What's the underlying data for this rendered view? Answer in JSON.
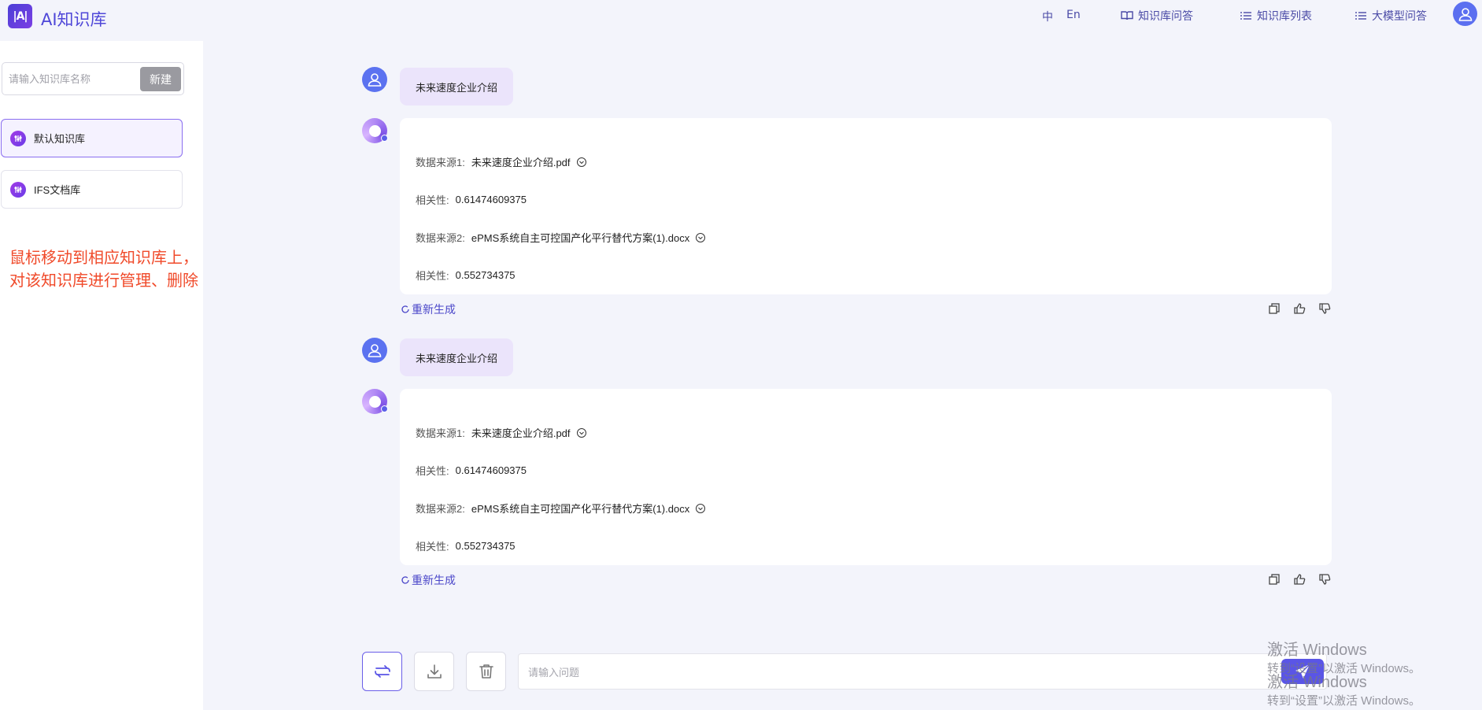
{
  "header": {
    "logo_mark": "|A|",
    "app_title": "AI知识库",
    "lang_zh": "中",
    "lang_en": "En",
    "nav": [
      {
        "label": "知识库问答",
        "icon": "book-icon"
      },
      {
        "label": "知识库列表",
        "icon": "list-icon"
      },
      {
        "label": "大模型问答",
        "icon": "list-icon"
      }
    ],
    "user_icon": "user-icon"
  },
  "sidebar": {
    "search_placeholder": "请输入知识库名称",
    "new_button": "新建",
    "items": [
      {
        "label": "默认知识库",
        "active": true,
        "icon": "knowledge-base-icon"
      },
      {
        "label": "IFS文档库",
        "active": false,
        "icon": "knowledge-base-icon"
      }
    ],
    "annotation_line1": "鼠标移动到相应知识库上，",
    "annotation_line2": "对该知识库进行管理、删除"
  },
  "conversation": [
    {
      "question": "未来速度企业介绍",
      "answer": {
        "source1_label": "数据来源1:",
        "source1_file": "未来速度企业介绍.pdf",
        "relevance1_label": "相关性:",
        "relevance1_value": "0.61474609375",
        "source2_label": "数据来源2:",
        "source2_file": "ePMS系统自主可控国产化平行替代方案(1).docx",
        "relevance2_label": "相关性:",
        "relevance2_value": "0.552734375"
      },
      "regenerate": "重新生成"
    },
    {
      "question": "未来速度企业介绍",
      "answer": {
        "source1_label": "数据来源1:",
        "source1_file": "未来速度企业介绍.pdf",
        "relevance1_label": "相关性:",
        "relevance1_value": "0.61474609375",
        "source2_label": "数据来源2:",
        "source2_file": "ePMS系统自主可控国产化平行替代方案(1).docx",
        "relevance2_label": "相关性:",
        "relevance2_value": "0.552734375"
      },
      "regenerate": "重新生成"
    }
  ],
  "input_bar": {
    "placeholder": "请输入问题",
    "tools": [
      "switch-icon",
      "download-icon",
      "trash-icon"
    ],
    "send_icon": "send-icon"
  },
  "watermark": {
    "title": "激活 Windows",
    "subtitle": "转到“设置”以激活 Windows。"
  },
  "colors": {
    "accent": "#4f47d8",
    "annotation": "#f04a2a",
    "question_bubble": "#ebe4fb",
    "background": "#f3f4fb"
  }
}
